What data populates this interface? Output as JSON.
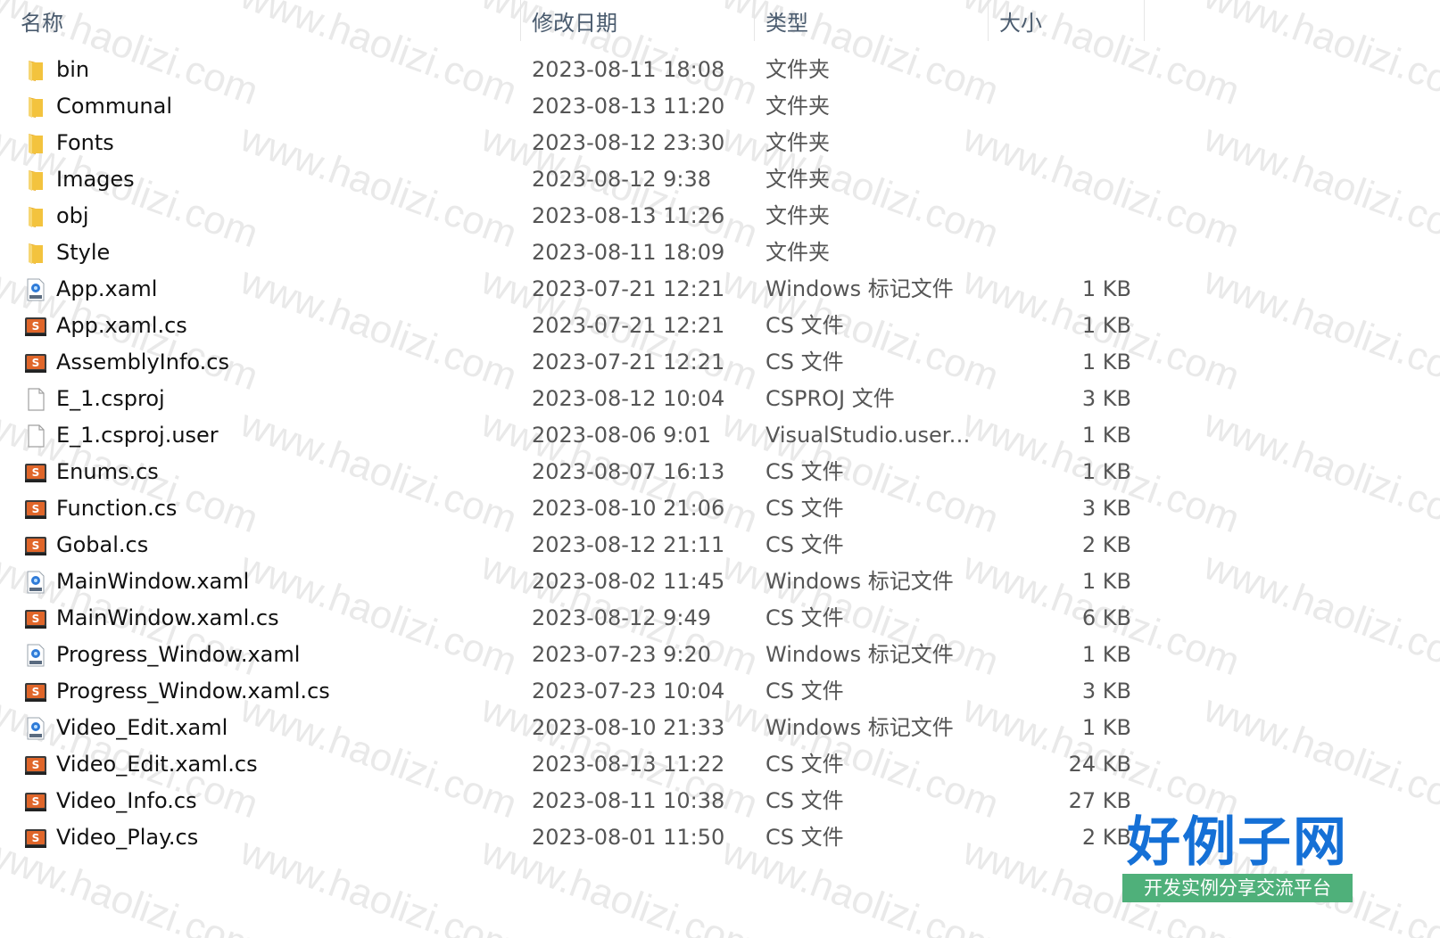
{
  "columns": {
    "name": "名称",
    "date": "修改日期",
    "type": "类型",
    "size": "大小"
  },
  "files": [
    {
      "name": "bin",
      "date": "2023-08-11 18:08",
      "type": "文件夹",
      "size": "",
      "icon": "folder-icon"
    },
    {
      "name": "Communal",
      "date": "2023-08-13 11:20",
      "type": "文件夹",
      "size": "",
      "icon": "folder-icon"
    },
    {
      "name": "Fonts",
      "date": "2023-08-12 23:30",
      "type": "文件夹",
      "size": "",
      "icon": "folder-icon"
    },
    {
      "name": "Images",
      "date": "2023-08-12 9:38",
      "type": "文件夹",
      "size": "",
      "icon": "folder-icon"
    },
    {
      "name": "obj",
      "date": "2023-08-13 11:26",
      "type": "文件夹",
      "size": "",
      "icon": "folder-icon"
    },
    {
      "name": "Style",
      "date": "2023-08-11 18:09",
      "type": "文件夹",
      "size": "",
      "icon": "folder-icon"
    },
    {
      "name": "App.xaml",
      "date": "2023-07-21 12:21",
      "type": "Windows 标记文件",
      "size": "1 KB",
      "icon": "xaml-file-icon"
    },
    {
      "name": "App.xaml.cs",
      "date": "2023-07-21 12:21",
      "type": "CS 文件",
      "size": "1 KB",
      "icon": "cs-file-icon"
    },
    {
      "name": "AssemblyInfo.cs",
      "date": "2023-07-21 12:21",
      "type": "CS 文件",
      "size": "1 KB",
      "icon": "cs-file-icon"
    },
    {
      "name": "E_1.csproj",
      "date": "2023-08-12 10:04",
      "type": "CSPROJ 文件",
      "size": "3 KB",
      "icon": "blank-file-icon"
    },
    {
      "name": "E_1.csproj.user",
      "date": "2023-08-06 9:01",
      "type": "VisualStudio.user.a...",
      "size": "1 KB",
      "icon": "blank-file-icon"
    },
    {
      "name": "Enums.cs",
      "date": "2023-08-07 16:13",
      "type": "CS 文件",
      "size": "1 KB",
      "icon": "cs-file-icon"
    },
    {
      "name": "Function.cs",
      "date": "2023-08-10 21:06",
      "type": "CS 文件",
      "size": "3 KB",
      "icon": "cs-file-icon"
    },
    {
      "name": "Gobal.cs",
      "date": "2023-08-12 21:11",
      "type": "CS 文件",
      "size": "2 KB",
      "icon": "cs-file-icon"
    },
    {
      "name": "MainWindow.xaml",
      "date": "2023-08-02 11:45",
      "type": "Windows 标记文件",
      "size": "1 KB",
      "icon": "xaml-file-icon"
    },
    {
      "name": "MainWindow.xaml.cs",
      "date": "2023-08-12 9:49",
      "type": "CS 文件",
      "size": "6 KB",
      "icon": "cs-file-icon"
    },
    {
      "name": "Progress_Window.xaml",
      "date": "2023-07-23 9:20",
      "type": "Windows 标记文件",
      "size": "1 KB",
      "icon": "xaml-file-icon"
    },
    {
      "name": "Progress_Window.xaml.cs",
      "date": "2023-07-23 10:04",
      "type": "CS 文件",
      "size": "3 KB",
      "icon": "cs-file-icon"
    },
    {
      "name": "Video_Edit.xaml",
      "date": "2023-08-10 21:33",
      "type": "Windows 标记文件",
      "size": "1 KB",
      "icon": "xaml-file-icon"
    },
    {
      "name": "Video_Edit.xaml.cs",
      "date": "2023-08-13 11:22",
      "type": "CS 文件",
      "size": "24 KB",
      "icon": "cs-file-icon"
    },
    {
      "name": "Video_Info.cs",
      "date": "2023-08-11 10:38",
      "type": "CS 文件",
      "size": "27 KB",
      "icon": "cs-file-icon"
    },
    {
      "name": "Video_Play.cs",
      "date": "2023-08-01 11:50",
      "type": "CS 文件",
      "size": "2 KB",
      "icon": "cs-file-icon"
    }
  ],
  "watermark": {
    "text": "www.haolizi.com"
  },
  "logo": {
    "title": "好例子网",
    "subtitle": "开发实例分享交流平台"
  },
  "colors": {
    "folder": "#f3c33e",
    "cs_icon": "#e0662a",
    "header_text": "#4a5b6e",
    "logo_blue": "#1570d6",
    "logo_green": "#4fb07a"
  }
}
